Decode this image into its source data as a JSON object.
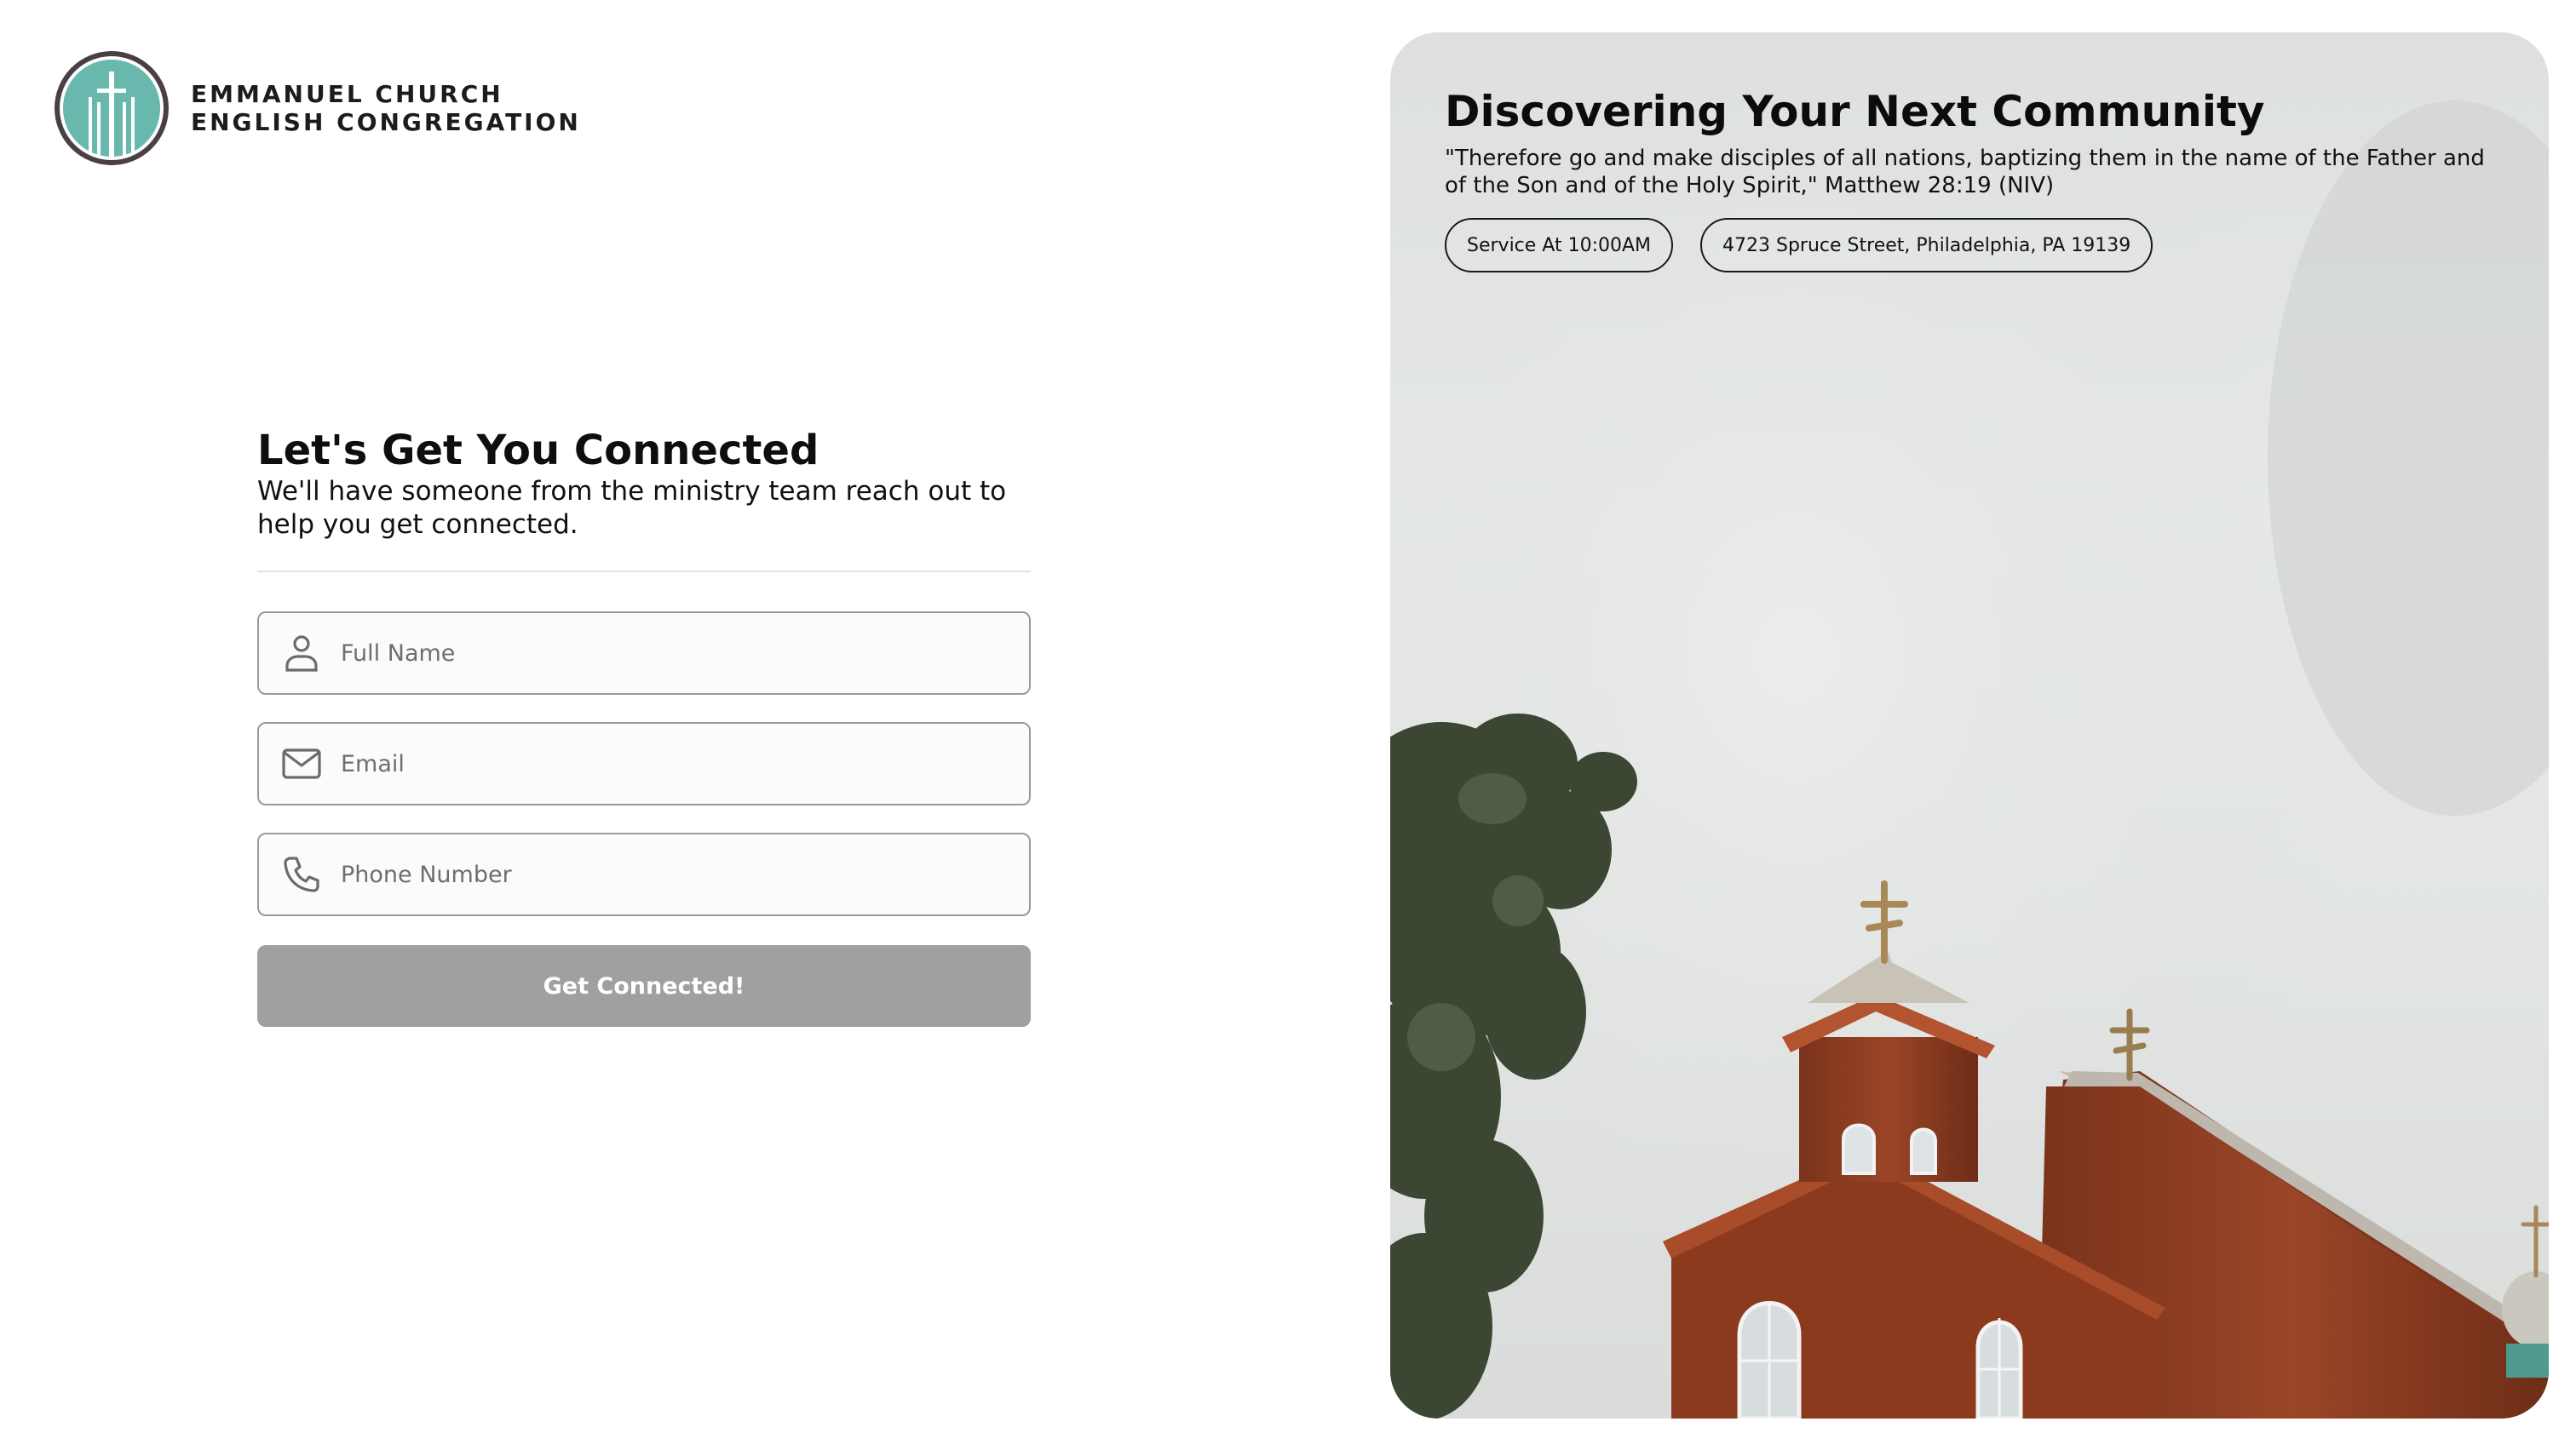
{
  "brand": {
    "line1": "EMMANUEL CHURCH",
    "line2": "ENGLISH CONGREGATION",
    "logo_icon": "church-cross-logo-icon",
    "logo_color": "#69b8ae",
    "logo_ring_color": "#4a3f42"
  },
  "form": {
    "title": "Let's Get You Connected",
    "subtitle": "We'll have someone from the ministry team reach out to help you get connected.",
    "fields": [
      {
        "icon": "person-icon",
        "placeholder": "Full Name",
        "value": ""
      },
      {
        "icon": "mail-icon",
        "placeholder": "Email",
        "value": ""
      },
      {
        "icon": "phone-icon",
        "placeholder": "Phone Number",
        "value": ""
      }
    ],
    "submit_label": "Get Connected!",
    "submit_color": "#a0a0a0"
  },
  "hero": {
    "title": "Discovering Your Next Community",
    "quote": "\"Therefore go and make disciples of all nations, baptizing them in the name of the Father and of the Son and of the Holy Spirit,\" Matthew 28:19 (NIV)",
    "pills": [
      "Service At 10:00AM",
      "4723 Spruce Street, Philadelphia, PA 19139"
    ],
    "image": "wooden-church-steeple-photo"
  }
}
